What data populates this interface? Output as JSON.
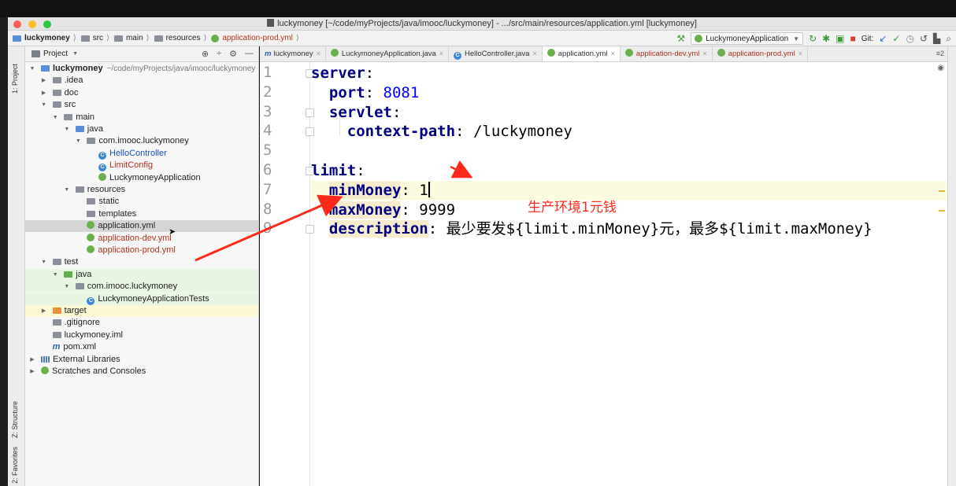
{
  "window": {
    "title": "luckymoney [~/code/myProjects/java/imooc/luckymoney] - .../src/main/resources/application.yml [luckymoney]"
  },
  "breadcrumb": [
    "luckymoney",
    "src",
    "main",
    "resources",
    "application-prod.yml"
  ],
  "toolbar": {
    "run_config": "LuckymoneyApplication",
    "git_label": "Git:"
  },
  "side_labels": {
    "project": "1: Project",
    "structure": "Z: Structure",
    "favorites": "2: Favorites"
  },
  "project_panel": {
    "title": "Project",
    "tree": [
      {
        "label": "luckymoney",
        "hint": "~/code/myProjects/java/imooc/luckymoney",
        "depth": 0,
        "arrow": "down",
        "icon": "module",
        "style": "bold"
      },
      {
        "label": ".idea",
        "depth": 1,
        "arrow": "right",
        "icon": "folder"
      },
      {
        "label": "doc",
        "depth": 1,
        "arrow": "right",
        "icon": "folder"
      },
      {
        "label": "src",
        "depth": 1,
        "arrow": "down",
        "icon": "folder"
      },
      {
        "label": "main",
        "depth": 2,
        "arrow": "down",
        "icon": "folder"
      },
      {
        "label": "java",
        "depth": 3,
        "arrow": "down",
        "icon": "folder-blue"
      },
      {
        "label": "com.imooc.luckymoney",
        "depth": 4,
        "arrow": "down",
        "icon": "package"
      },
      {
        "label": "HelloController",
        "depth": 5,
        "icon": "class",
        "style": "blue"
      },
      {
        "label": "LimitConfig",
        "depth": 5,
        "icon": "class",
        "style": "red"
      },
      {
        "label": "LuckymoneyApplication",
        "depth": 5,
        "icon": "spring",
        "style": "normal"
      },
      {
        "label": "resources",
        "depth": 3,
        "arrow": "down",
        "icon": "folder-res"
      },
      {
        "label": "static",
        "depth": 4,
        "icon": "folder"
      },
      {
        "label": "templates",
        "depth": 4,
        "icon": "folder"
      },
      {
        "label": "application.yml",
        "depth": 4,
        "icon": "spring",
        "style": "normal",
        "row": "sel"
      },
      {
        "label": "application-dev.yml",
        "depth": 4,
        "icon": "spring",
        "style": "red"
      },
      {
        "label": "application-prod.yml",
        "depth": 4,
        "icon": "spring",
        "style": "red"
      },
      {
        "label": "test",
        "depth": 1,
        "arrow": "down",
        "icon": "folder"
      },
      {
        "label": "java",
        "depth": 2,
        "arrow": "down",
        "icon": "folder-green",
        "row": "green"
      },
      {
        "label": "com.imooc.luckymoney",
        "depth": 3,
        "arrow": "down",
        "icon": "package",
        "row": "green"
      },
      {
        "label": "LuckymoneyApplicationTests",
        "depth": 4,
        "icon": "class-test",
        "row": "green"
      },
      {
        "label": "target",
        "depth": 1,
        "arrow": "right",
        "icon": "folder-orange",
        "row": "yellow"
      },
      {
        "label": ".gitignore",
        "depth": 1,
        "icon": "file"
      },
      {
        "label": "luckymoney.iml",
        "depth": 1,
        "icon": "file"
      },
      {
        "label": "pom.xml",
        "depth": 1,
        "icon": "maven"
      },
      {
        "label": "External Libraries",
        "depth": 0,
        "arrow": "right",
        "icon": "libs"
      },
      {
        "label": "Scratches and Consoles",
        "depth": 0,
        "arrow": "right",
        "icon": "scratch"
      }
    ]
  },
  "editor_tabs": [
    {
      "label": "luckymoney",
      "icon": "maven"
    },
    {
      "label": "LuckymoneyApplication.java",
      "icon": "spring"
    },
    {
      "label": "HelloController.java",
      "icon": "class"
    },
    {
      "label": "application.yml",
      "icon": "spring",
      "active": true
    },
    {
      "label": "application-dev.yml",
      "icon": "spring",
      "red": true
    },
    {
      "label": "application-prod.yml",
      "icon": "spring",
      "red": true
    }
  ],
  "tab_split_label": "≡2",
  "editor": {
    "line_numbers": [
      "1",
      "2",
      "3",
      "4",
      "5",
      "6",
      "7",
      "8",
      "9"
    ],
    "lines": [
      {
        "indent": "",
        "key": "server",
        "sep": ":",
        "value": ""
      },
      {
        "indent": "  ",
        "key": "port",
        "sep": ": ",
        "value": "8081",
        "vtype": "num"
      },
      {
        "indent": "  ",
        "key": "servlet",
        "sep": ":",
        "value": ""
      },
      {
        "indent": "    ",
        "key": "context-path",
        "sep": ": ",
        "value": "/luckymoney"
      },
      {
        "indent": "",
        "key": "",
        "sep": "",
        "value": ""
      },
      {
        "indent": "",
        "key": "limit",
        "sep": ":",
        "value": ""
      },
      {
        "indent": "  ",
        "key": "minMoney",
        "sep": ": ",
        "value": "1",
        "cur": true
      },
      {
        "indent": "  ",
        "key": "maxMoney",
        "sep": ": ",
        "value": "9999"
      },
      {
        "indent": "  ",
        "key": "description",
        "sep": ": ",
        "value": "最少要发${limit.minMoney}元，最多${limit.maxMoney}"
      }
    ]
  },
  "annotation": "生产环境1元钱",
  "colors": {
    "annotation": "#ff2a1a",
    "yaml_key": "#000080",
    "number": "#0000ff",
    "selected_row": "#d5d5d5",
    "current_line": "#fcfadf"
  }
}
